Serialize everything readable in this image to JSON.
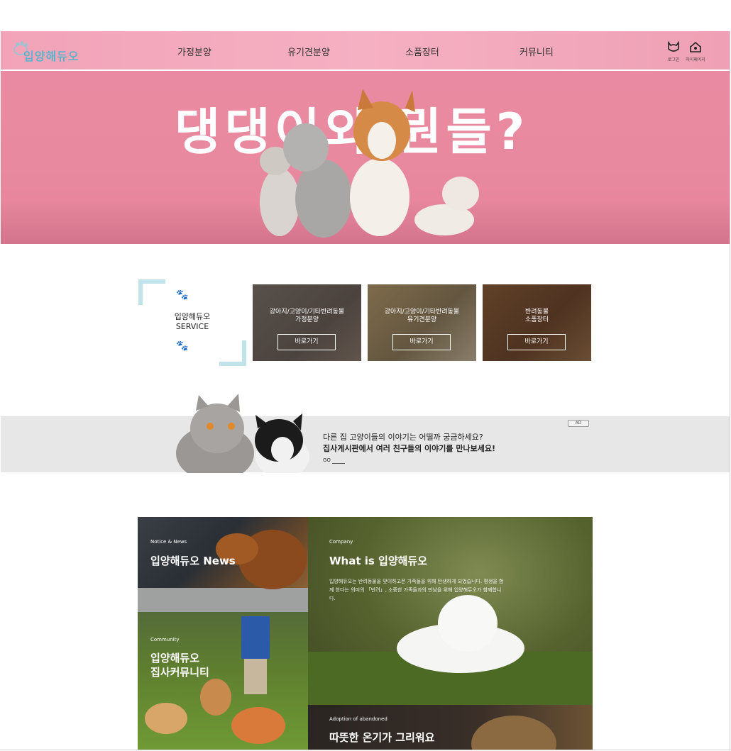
{
  "header": {
    "logo_text": "입양해듀오",
    "nav": [
      "가정분양",
      "유기견분양",
      "소품장터",
      "커뮤니티"
    ],
    "login_label": "로그인",
    "mypage_label": "마이페이지"
  },
  "hero": {
    "title": "댕댕이와 뭔들?"
  },
  "service": {
    "title_line1": "입양해듀오",
    "title_line2": "SERVICE",
    "cards": [
      {
        "line1": "강아지/고양이/기타반려동물",
        "line2": "가정분양",
        "button": "바로가기"
      },
      {
        "line1": "강아지/고양이/기타반려동물",
        "line2": "유기견분양",
        "button": "바로가기"
      },
      {
        "line1": "반려동물",
        "line2": "소품장터",
        "button": "바로가기"
      }
    ]
  },
  "banner": {
    "line1": "다른 집 고양이들의 이야기는 어떨까 궁금하세요?",
    "line2": "집사게시판에서 여러 친구들의 이야기를 만나보세요!",
    "go": "GO",
    "ad": "AD"
  },
  "grid": {
    "news": {
      "small": "Notice & News",
      "big": "입양해듀오 News"
    },
    "community": {
      "small": "Community",
      "big_line1": "입양해듀오",
      "big_line2": "집사커뮤니티"
    },
    "company": {
      "small": "Company",
      "big": "What is 입양해듀오",
      "desc": "입양해듀오는 반려동물을 맞이하고픈 가족들을 위해 탄생하게 되었습니다. 평생을 함께 한다는 의미의 「반려」, 소중한 가족들과의 만남을 위해 입양해듀오가 함께합니다."
    },
    "adoption": {
      "small": "Adoption of abandoned",
      "big": "따뜻한 온기가 그리워요"
    }
  },
  "colors": {
    "header_pink": "#f2a3b8",
    "hero_pink": "#e98aa2",
    "accent_mint": "#bfe3e8",
    "logo_blue": "#5fb3c9"
  }
}
